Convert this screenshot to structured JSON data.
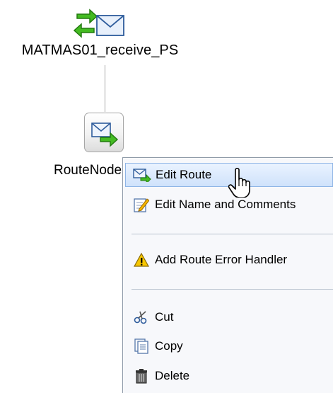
{
  "proxy_node": {
    "label": "MATMAS01_receive_PS",
    "icon": "proxy-service-envelope-icon"
  },
  "route_node": {
    "label": "RouteNode1",
    "icon": "route-envelope-icon"
  },
  "context_menu": {
    "items": [
      {
        "label": "Edit Route",
        "icon": "edit-route-icon"
      },
      {
        "label": "Edit Name and Comments",
        "icon": "edit-pencil-icon"
      },
      {
        "label": "Add Route Error Handler",
        "icon": "warning-icon"
      },
      {
        "label": "Cut",
        "icon": "scissors-icon"
      },
      {
        "label": "Copy",
        "icon": "copy-icon"
      },
      {
        "label": "Delete",
        "icon": "trash-icon"
      }
    ],
    "hovered_item": "Edit Route"
  },
  "colors": {
    "menu_bg": "#f7f8fb",
    "hover_bg": "#cfe2fb",
    "accent_green": "#33aa22"
  },
  "cursor": "hand-pointer-icon"
}
